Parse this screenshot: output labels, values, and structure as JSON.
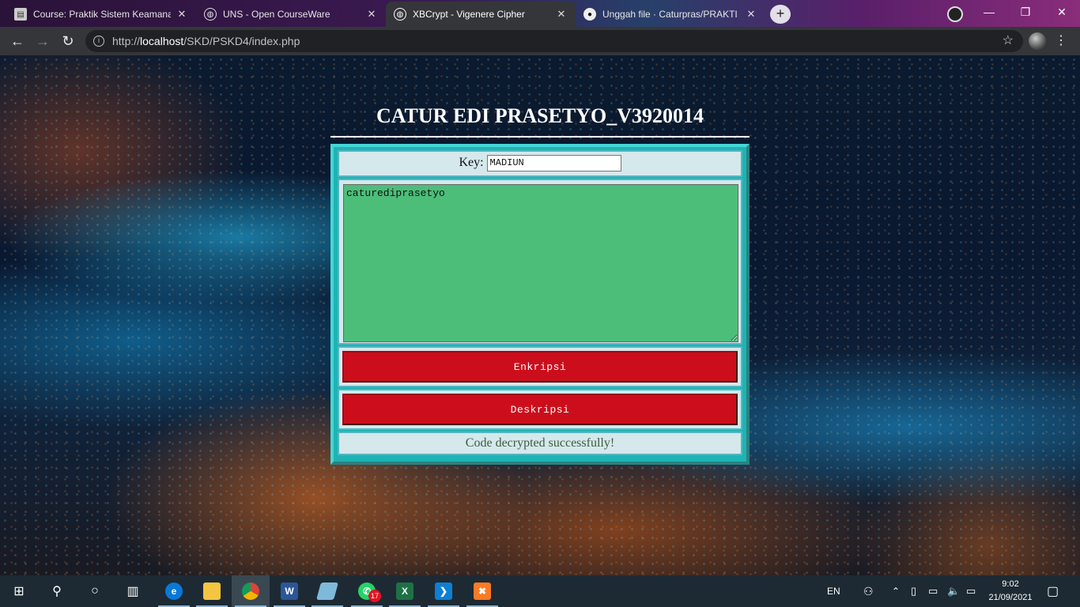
{
  "browser": {
    "tabs": [
      {
        "title": "Course: Praktik Sistem Keamanan",
        "active": false
      },
      {
        "title": "UNS - Open CourseWare",
        "active": false
      },
      {
        "title": "XBCrypt - Vigenere Cipher",
        "active": true
      },
      {
        "title": "Unggah file · Caturpras/PRAKTI",
        "active": false
      }
    ],
    "new_tab_icon": "+",
    "url_prefix": "http://",
    "url_host": "localhost",
    "url_path": "/SKD/PSKD4/index.php"
  },
  "page": {
    "title": "CATUR EDI PRASETYO_V3920014",
    "key_label": "Key:",
    "key_value": "MADIUN",
    "text_value": "caturediprasetyo",
    "encrypt_label": "Enkripsi",
    "decrypt_label": "Deskripsi",
    "status": "Code decrypted successfully!"
  },
  "colors": {
    "box_border": "#1fb3b3",
    "textarea_bg": "#4dbd7a",
    "button_bg": "#cc0e1c",
    "cell_bg": "#d5e8ec"
  },
  "taskbar": {
    "apps": [
      "start-icon",
      "search-icon",
      "cortana-icon",
      "task-view-icon",
      "edge-icon",
      "file-explorer-icon",
      "chrome-icon",
      "word-icon",
      "notes-icon",
      "whatsapp-icon",
      "excel-icon",
      "vscode-icon",
      "xampp-icon"
    ],
    "whatsapp_badge": "17",
    "language": "EN",
    "time": "9:02",
    "date": "21/09/2021"
  }
}
